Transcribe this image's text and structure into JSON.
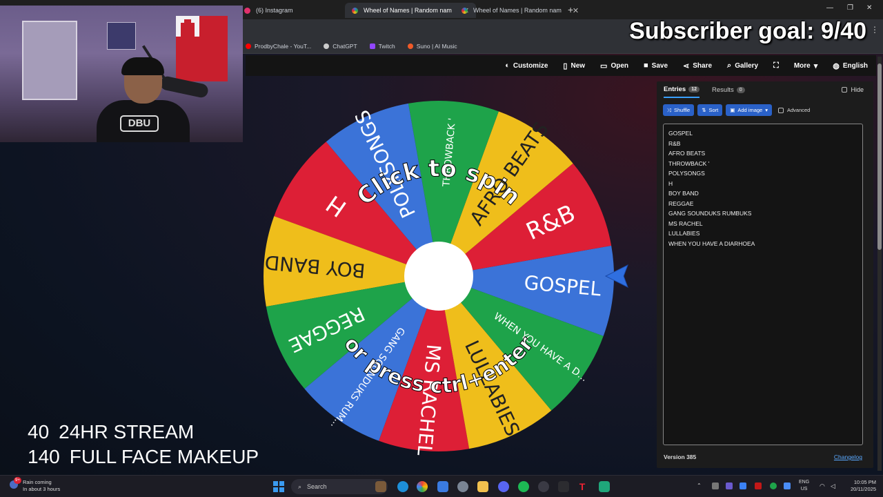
{
  "browser": {
    "tabs": [
      {
        "label": "(6) Instagram",
        "favicon_color": "#e1306c"
      },
      {
        "label": "Wheel of Names | Random nam",
        "favicon_color": "#4a8df8",
        "active": true
      },
      {
        "label": "Wheel of Names | Random nam",
        "favicon_color": "#4a8df8"
      }
    ],
    "new_tab": "+",
    "bookmarks": [
      {
        "label": "ProdbyChale - YouT...",
        "color": "#ff0000"
      },
      {
        "label": "ChatGPT",
        "color": "#cccccc"
      },
      {
        "label": "Twitch",
        "color": "#9146ff"
      },
      {
        "label": "Suno | AI Music",
        "color": "#f05a28"
      }
    ]
  },
  "overlay": {
    "subscriber_goal": "Subscriber goal: 9/40",
    "stats": [
      {
        "num": "40",
        "label": "24HR STREAM"
      },
      {
        "num": "140",
        "label": "FULL FACE MAKEUP"
      }
    ]
  },
  "webcam": {
    "logo_text": "DBU"
  },
  "toolbar": {
    "items": [
      {
        "label": "Customize",
        "icon": "palette-icon",
        "glyph": "◐"
      },
      {
        "label": "New",
        "icon": "file-icon",
        "glyph": "▯"
      },
      {
        "label": "Open",
        "icon": "folder-icon",
        "glyph": "▭"
      },
      {
        "label": "Save",
        "icon": "save-icon",
        "glyph": "■"
      },
      {
        "label": "Share",
        "icon": "share-icon",
        "glyph": "⋖"
      },
      {
        "label": "Gallery",
        "icon": "search-icon",
        "glyph": "⌕"
      },
      {
        "label": "",
        "icon": "fullscreen-icon",
        "glyph": "⛶"
      },
      {
        "label": "More",
        "icon": "chevron-down-icon",
        "glyph": "▾"
      },
      {
        "label": "English",
        "icon": "globe-icon",
        "glyph": "◍"
      }
    ]
  },
  "wheel": {
    "prompt_top": "Click to spin",
    "prompt_bottom": "or press ctrl+enter",
    "colors": {
      "blue": "#3b73d8",
      "green": "#1ea34a",
      "yellow": "#efbe1b",
      "red": "#dd1f36"
    },
    "segments": [
      {
        "label": "GOSPEL",
        "color": "#3b73d8"
      },
      {
        "label": "R&B",
        "color": "#dd1f36"
      },
      {
        "label": "AFRO BEATS",
        "color": "#efbe1b"
      },
      {
        "label": "THROWBACK '",
        "color": "#1ea34a"
      },
      {
        "label": "POLYSONGS",
        "color": "#3b73d8"
      },
      {
        "label": "H",
        "color": "#dd1f36"
      },
      {
        "label": "BOY BAND",
        "color": "#efbe1b"
      },
      {
        "label": "REGGAE",
        "color": "#1ea34a"
      },
      {
        "label": "GANG SOUNDUKS RUM...",
        "color": "#3b73d8"
      },
      {
        "label": "MS RACHEL",
        "color": "#dd1f36"
      },
      {
        "label": "LULLABIES",
        "color": "#efbe1b"
      },
      {
        "label": "WHEN YOU HAVE A D...",
        "color": "#1ea34a"
      }
    ]
  },
  "panel": {
    "tab_entries": "Entries",
    "entries_count": "12",
    "tab_results": "Results",
    "results_count": "0",
    "hide_label": "Hide",
    "shuffle": "Shuffle",
    "sort": "Sort",
    "add_image": "Add image",
    "advanced": "Advanced",
    "entries": [
      "GOSPEL",
      "R&B",
      "AFRO BEATS",
      "THROWBACK '",
      "POLYSONGS",
      "H",
      "BOY BAND",
      "REGGAE",
      "GANG SOUNDUKS RUMBUKS",
      "MS RACHEL",
      "LULLABIES",
      "WHEN YOU HAVE A DIARHOEA"
    ],
    "version": "Version 385",
    "changelog": "Changelog"
  },
  "taskbar": {
    "weather_title": "Rain coming",
    "weather_sub": "In about 3 hours",
    "weather_badge": "9+",
    "search": "Search",
    "lang_1": "ENG",
    "lang_2": "US",
    "time": "10:05 PM",
    "date": "20/11/2025"
  }
}
